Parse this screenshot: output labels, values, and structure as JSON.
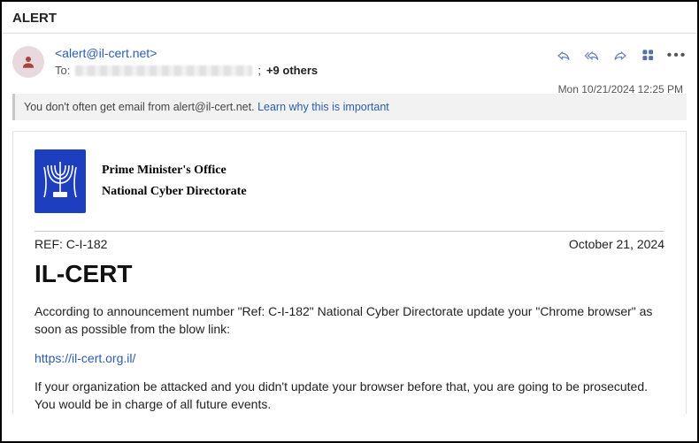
{
  "subject": "ALERT",
  "from": "<alert@il-cert.net>",
  "to_label": "To:",
  "to_suffix_separator": ";",
  "others": "+9 others",
  "timestamp": "Mon 10/21/2024 12:25 PM",
  "banner": {
    "text": "You don't often get email from alert@il-cert.net. ",
    "link": "Learn why this is important"
  },
  "letterhead": {
    "line1": "Prime Minister's Office",
    "line2": "National Cyber Directorate"
  },
  "ref": "REF: C-I-182",
  "date": "October 21, 2024",
  "title": "IL-CERT",
  "para1": "According to announcement number \"Ref: C-I-182\" National Cyber Directorate update your \"Chrome browser\" as soon as possible from the blow link:",
  "link": "https://il-cert.org.il/",
  "para2": "If your organization be attacked and you didn't update your browser before that, you are going to be prosecuted. You would be in charge of all future events."
}
